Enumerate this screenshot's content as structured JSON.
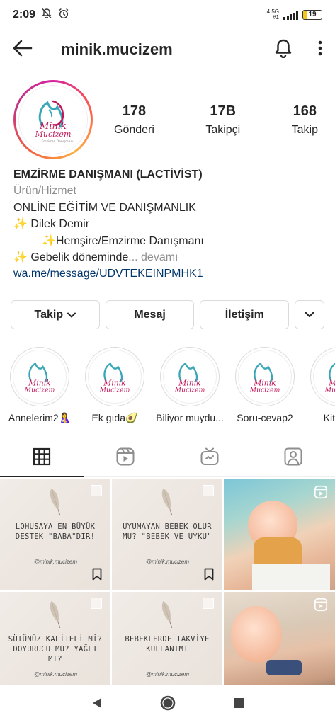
{
  "status_bar": {
    "time": "2:09",
    "network_type": "4.5G",
    "network_sub": "#1",
    "battery": "19",
    "battery_level_percent": 19
  },
  "header": {
    "username": "minik.mucizem"
  },
  "profile": {
    "avatar_logo_text": "Minik Mucizem",
    "avatar_logo_subtext": "Emzirme Danışmanı",
    "stats": [
      {
        "value": "178",
        "label": "Gönderi"
      },
      {
        "value": "17B",
        "label": "Takipçi"
      },
      {
        "value": "168",
        "label": "Takip"
      }
    ]
  },
  "bio": {
    "name": "EMZİRME DANIŞMANI (LACTİVİST)",
    "category": "Ürün/Hizmet",
    "line1": "ONLİNE EĞİTİM VE DANIŞMANLIK",
    "line2": "Dilek Demir",
    "line3": "Hemşire/Emzirme Danışmanı",
    "line4": "Gebelik döneminde",
    "more": "... devamı",
    "link": "wa.me/message/UDVTEKEINPMHK1"
  },
  "buttons": {
    "follow": "Takip",
    "message": "Mesaj",
    "contact": "İletişim"
  },
  "highlights": [
    {
      "label": "Annelerim2🤱"
    },
    {
      "label": "Ek gıda🥑"
    },
    {
      "label": "Biliyor muydu..."
    },
    {
      "label": "Soru-cevap2"
    },
    {
      "label": "Kitap Ö"
    }
  ],
  "tabs": [
    "grid-icon",
    "reels-icon",
    "igtv-icon",
    "tagged-icon"
  ],
  "posts": [
    {
      "type": "text",
      "caption": "LOHUSAYA EN BÜYÜK DESTEK \"BABA\"DIR!",
      "handle": "@minik.mucizem"
    },
    {
      "type": "text",
      "caption": "UYUMAYAN BEBEK OLUR MU? \"BEBEK VE UYKU\"",
      "handle": "@minik.mucizem"
    },
    {
      "type": "reel-photo"
    },
    {
      "type": "text",
      "caption": "SÜTÜNÜZ KALİTELİ Mİ? DOYURUCU MU? YAĞLI MI?",
      "handle": "@minik.mucizem"
    },
    {
      "type": "text",
      "caption": "BEBEKLERDE TAKVİYE KULLANIMI",
      "handle": "@minik.mucizem"
    },
    {
      "type": "reel-photo"
    }
  ],
  "colors": {
    "text": "#262626",
    "secondary": "#8e8e8e",
    "link": "#00376b",
    "border": "#dbdbdb",
    "logo_teal": "#3aa7b8",
    "logo_magenta": "#c2185b"
  }
}
